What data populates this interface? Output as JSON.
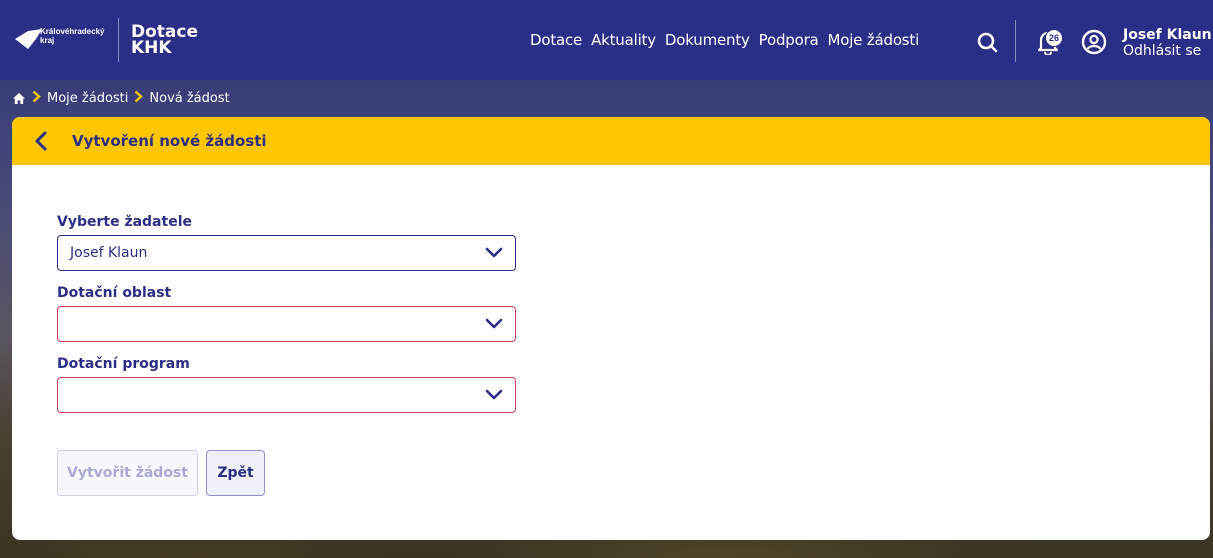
{
  "brand": {
    "region": "Královéhradecký kraj",
    "app_name": "Dotace\nKHK"
  },
  "nav": {
    "items": [
      "Dotace",
      "Aktuality",
      "Dokumenty",
      "Podpora",
      "Moje žádosti"
    ]
  },
  "header": {
    "notification_count": "26",
    "user_name": "Josef Klaun",
    "logout_label": "Odhlásit se"
  },
  "breadcrumb": {
    "items": [
      "Moje žádosti",
      "Nová žádost"
    ]
  },
  "page": {
    "title": "Vytvoření nové žádosti"
  },
  "form": {
    "applicant": {
      "label": "Vyberte žadatele",
      "value": "Josef Klaun"
    },
    "area": {
      "label": "Dotační oblast",
      "value": ""
    },
    "program": {
      "label": "Dotační program",
      "value": ""
    }
  },
  "actions": {
    "create_label": "Vytvořit žádost",
    "back_label": "Zpět"
  },
  "colors": {
    "primary": "#2b2e86",
    "accent": "#fcc600",
    "error": "#d23a55"
  },
  "icons": [
    "home-icon",
    "search-icon",
    "bell-icon",
    "user-circle-icon",
    "chevron-down-icon",
    "arrow-left-icon"
  ]
}
